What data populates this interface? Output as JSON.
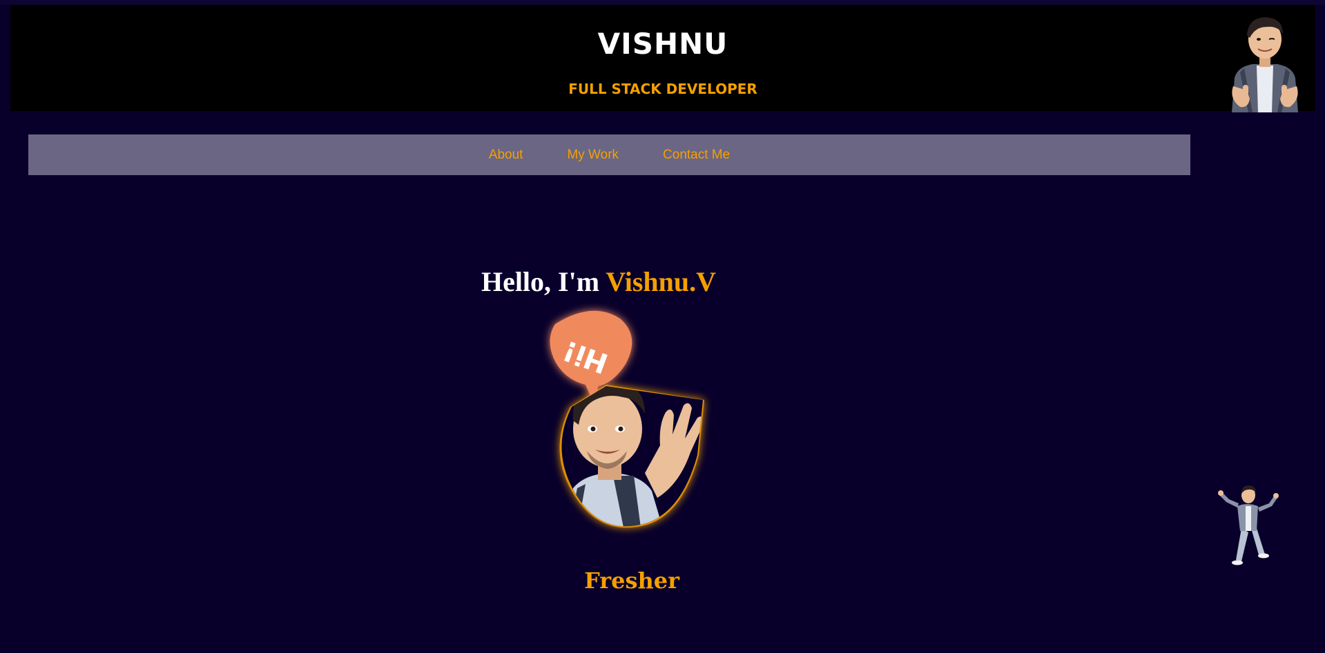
{
  "header": {
    "name": "VISHNU",
    "role": "FULL STACK DEVELOPER",
    "avatar_icon": "avatar-thumbs-up-icon"
  },
  "nav": {
    "items": [
      {
        "label": "About"
      },
      {
        "label": "My Work"
      },
      {
        "label": "Contact Me"
      }
    ]
  },
  "hero": {
    "greeting": "Hello, I'm ",
    "name": "Vishnu.V",
    "speech_bubble_text": "Hi!",
    "avatar_icon": "avatar-waving-icon",
    "status": "Fresher"
  },
  "dancing_avatar_icon": "avatar-dancing-icon",
  "colors": {
    "background": "#08002b",
    "header_bg": "#000000",
    "nav_bg": "#6b6683",
    "accent": "#f5a000",
    "text": "#ffffff"
  }
}
